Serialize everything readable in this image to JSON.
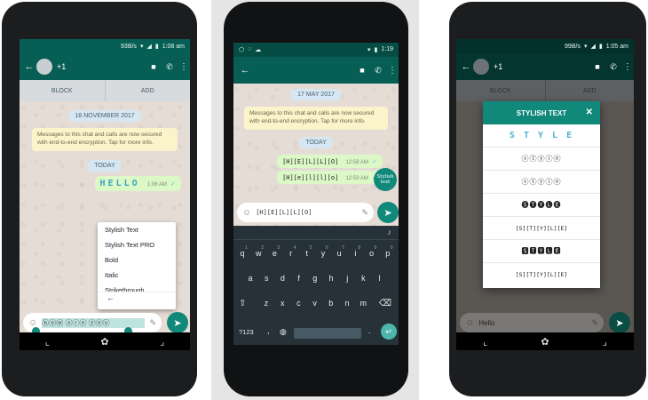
{
  "phone1": {
    "status": {
      "speed": "93B/s",
      "time": "1:08 am"
    },
    "contact": "+1",
    "actions": [
      "BLOCK",
      "ADD"
    ],
    "date_chip": "18 NOVEMBER 2017",
    "encryption_note": "Messages to this chat and calls are now secured with end-to-end encryption. Tap for more info.",
    "today_chip": "TODAY",
    "message": {
      "text": "HELLO",
      "time": "1:06 AM",
      "tick": "✓"
    },
    "context_menu": [
      "Stylish Text",
      "Stylish Text PRO",
      "Bold",
      "Italic",
      "Strikethrough"
    ],
    "back_arrow": "←",
    "input_text": "ⓗⓞⓦ ⓐⓡⓔ ⓨⓞⓤ"
  },
  "phone2": {
    "status": {
      "time": "1:19"
    },
    "date_chip": "17 MAY 2017",
    "encryption_note": "Messages to this chat and calls are now secured with end-to-end encryption. Tap for more info.",
    "today_chip": "TODAY",
    "messages": [
      {
        "text": "[H][E][L][L][O]",
        "time": "12:58 AM",
        "tick": "✓"
      },
      {
        "text": "[H][e][l][l][o]",
        "time": "12:59 AM",
        "tick": "✓"
      }
    ],
    "stylish_badge": "Stylish text",
    "input_text": "[H][E][L][L][O]",
    "keyboard": {
      "row1": [
        "q",
        "w",
        "e",
        "r",
        "t",
        "y",
        "u",
        "i",
        "o",
        "p"
      ],
      "row1_digits": [
        "1",
        "2",
        "3",
        "4",
        "5",
        "6",
        "7",
        "8",
        "9",
        "0"
      ],
      "row2": [
        "a",
        "s",
        "d",
        "f",
        "g",
        "h",
        "j",
        "k",
        "l"
      ],
      "row3": [
        "z",
        "x",
        "c",
        "v",
        "b",
        "n",
        "m"
      ],
      "sym_key": "?123",
      "comma": ",",
      "period": "."
    }
  },
  "phone3": {
    "status": {
      "speed": "99B/s",
      "time": "1:05 am"
    },
    "contact": "+1",
    "actions": [
      "BLOCK",
      "ADD"
    ],
    "dialog": {
      "title": "STYLISH TEXT",
      "close": "✕",
      "options": [
        "S T Y L E",
        "ⓢⓣⓨⓛⓔ",
        "ⓢⓣⓨⓛⓔ",
        "🅢🅣🅨🅛🅔",
        "[S][T][Y][L][E]",
        "🆂🆃🆈🅻🅴",
        "[S][T][Y][L][E]"
      ]
    },
    "input_text": "Hello"
  },
  "colors": {
    "whatsapp_teal": "#075e54",
    "accent": "#10897b",
    "keyboard_bg": "#263238"
  }
}
